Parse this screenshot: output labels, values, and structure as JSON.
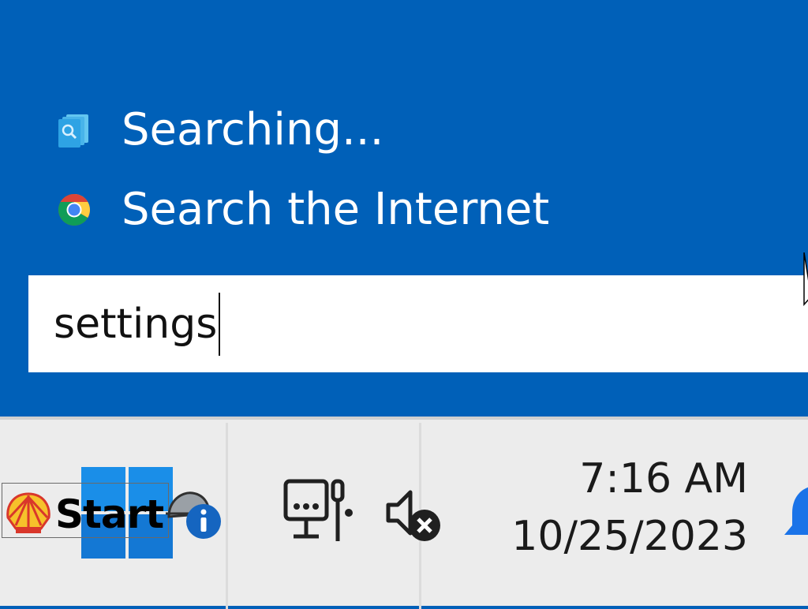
{
  "search_panel": {
    "results": [
      {
        "label": "Searching...",
        "icon": "search-files-icon"
      },
      {
        "label": "Search the Internet",
        "icon": "chrome-icon"
      }
    ],
    "query": "settings"
  },
  "taskbar": {
    "start_label": "Start",
    "start_icon": "shell-icon",
    "windows_icon": "windows-logo-icon",
    "weather_icon": "weather-info-icon",
    "network_icon": "network-icon",
    "volume_icon": "volume-muted-icon",
    "clock": {
      "time": "7:16 AM",
      "date": "10/25/2023"
    },
    "notification_icon": "bell-icon"
  },
  "colors": {
    "panel_bg": "#0060b8",
    "taskbar_bg": "#ececec",
    "text_white": "#ffffff"
  }
}
